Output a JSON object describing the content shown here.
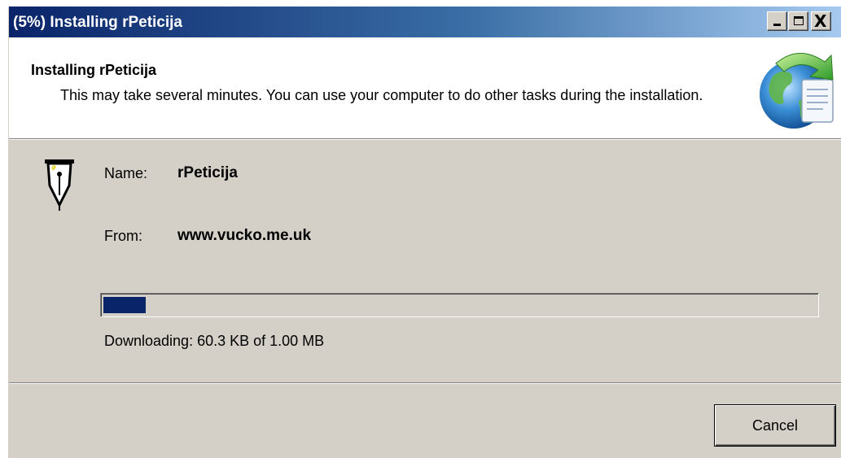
{
  "window": {
    "title": "(5%) Installing rPeticija",
    "controls": {
      "minimize_icon": "minimize-icon",
      "maximize_icon": "maximize-icon",
      "close_icon": "close-icon",
      "close_glyph": "X"
    }
  },
  "header": {
    "title": "Installing rPeticija",
    "description": "This may take several minutes. You can use your computer to do other tasks during the installation.",
    "icon": "globe-install-icon"
  },
  "app": {
    "icon": "pen-nib-icon",
    "name_label": "Name:",
    "name_value": "rPeticija",
    "from_label": "From:",
    "from_value": "www.vucko.me.uk"
  },
  "progress": {
    "fraction": 0.0589,
    "status": "Downloading: 60.3 KB of 1.00 MB",
    "fill_color": "#0a246a"
  },
  "buttons": {
    "cancel_label": "Cancel"
  },
  "colors": {
    "titlebar_start": "#0a246a",
    "titlebar_end": "#a6caf0",
    "dialog_face": "#d4d0c8"
  }
}
